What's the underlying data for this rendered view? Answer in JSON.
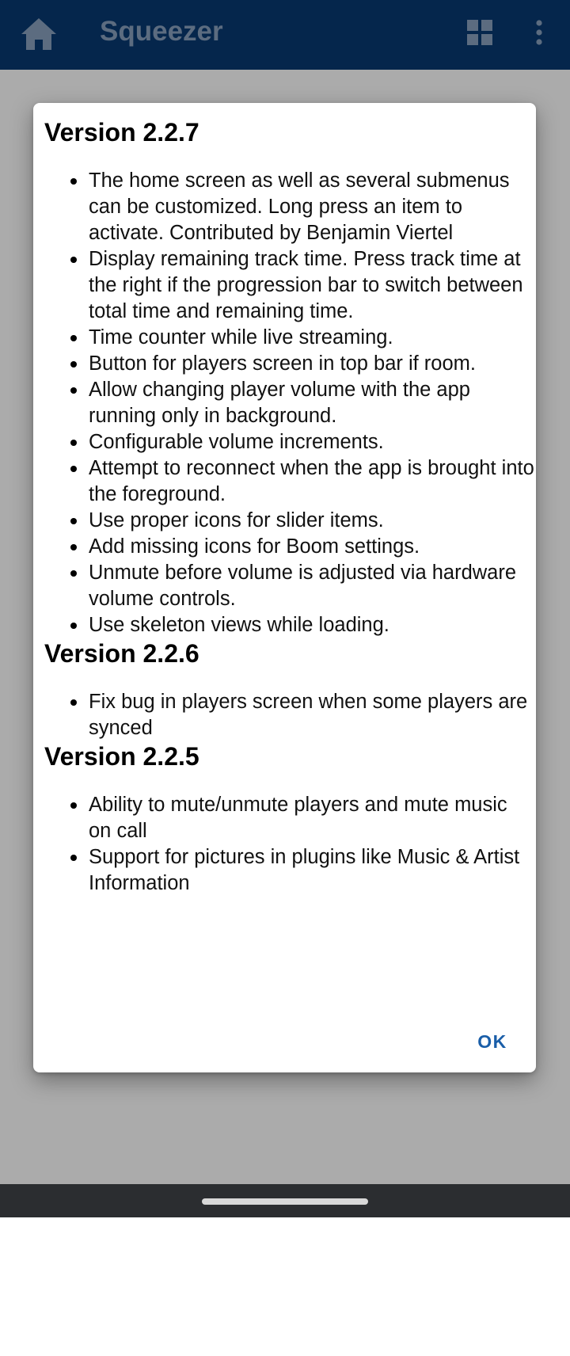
{
  "app_bar": {
    "title": "Squeezer",
    "home_icon": "home-icon",
    "grid_icon": "grid-view-icon",
    "more_icon": "more-vert-icon",
    "background_color": "#083a72",
    "title_color": "#8aa2bf"
  },
  "dialog": {
    "sections": [
      {
        "heading": "Version 2.2.7",
        "items": [
          "The home screen as well as several submenus can be customized. Long press an item to activate. Contributed by Benjamin Viertel",
          "Display remaining track time. Press track time at the right if the progression bar to switch between total time and remaining time.",
          "Time counter while live streaming.",
          "Button for players screen in top bar if room.",
          "Allow changing player volume with the app running only in background.",
          "Configurable volume increments.",
          "Attempt to reconnect when the app is brought into the foreground.",
          "Use proper icons for slider items.",
          "Add missing icons for Boom settings.",
          "Unmute before volume is adjusted via hardware volume controls.",
          "Use skeleton views while loading."
        ]
      },
      {
        "heading": "Version 2.2.6",
        "items": [
          "Fix bug in players screen when some players are synced"
        ]
      },
      {
        "heading": "Version 2.2.5",
        "items": [
          "Ability to mute/unmute players and mute music on call",
          "Support for pictures in plugins like Music & Artist Information"
        ]
      }
    ],
    "ok_label": "OK",
    "accent_color": "#1a5ea8"
  }
}
